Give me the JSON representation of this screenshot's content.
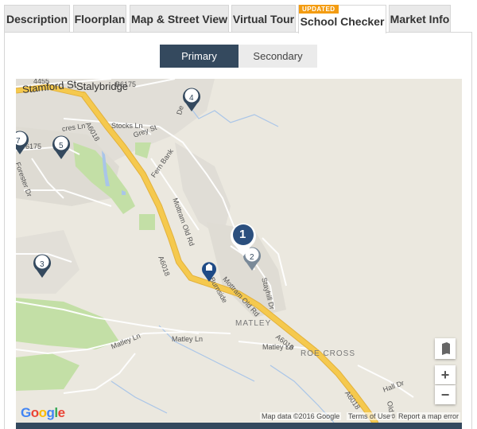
{
  "tabs": [
    {
      "label": "Description",
      "active": false
    },
    {
      "label": "Floorplan",
      "active": false
    },
    {
      "label": "Map & Street View",
      "active": false
    },
    {
      "label": "Virtual Tour",
      "active": false
    },
    {
      "label": "School Checker",
      "active": true,
      "badge": "UPDATED"
    },
    {
      "label": "Market Info",
      "active": false
    }
  ],
  "toggle": {
    "primary": "Primary",
    "secondary": "Secondary",
    "selected": "Primary"
  },
  "map": {
    "labels": {
      "stamford": "Stamford St",
      "stalybridge": "Stalybridge",
      "a6018a": "A6018",
      "a6018b": "A6018",
      "a6018c": "A6018",
      "a6018d": "A6018",
      "b6175": "B6175",
      "n6175": "6175",
      "stocks": "Stocks Ln",
      "acres": "cres Ln",
      "grey": "Grey St",
      "forester": "Forester Dr",
      "fern": "Fern Bank",
      "mottram1": "Mottram Old Rd",
      "mottram2": "Mottram Old Rd",
      "burnside": "Burnside",
      "matley": "MATLEY",
      "matleyln1": "Matley Ln",
      "matleyln2": "Matley Ln",
      "matleyln3": "Matley Ln",
      "roe": "ROE CROSS",
      "hall": "Hall Dr",
      "oldp": "Old P",
      "stayhill": "Stayhill Dr",
      "de": "De",
      "n4455": "4455"
    },
    "pins": [
      {
        "id": "1",
        "label": "1"
      },
      {
        "id": "2",
        "label": "2"
      },
      {
        "id": "3",
        "label": "3"
      },
      {
        "id": "4",
        "label": "4"
      },
      {
        "id": "5",
        "label": "5"
      },
      {
        "id": "7",
        "label": "7"
      }
    ],
    "google": "Google",
    "footer": {
      "data": "Map data ©2016 Google",
      "terms": "Terms of Use",
      "report": "Report a map error"
    },
    "zoom_in": "+",
    "zoom_out": "−"
  },
  "colors": {
    "accent": "#34495e",
    "badge": "#f39c12",
    "road": "#f5c94e",
    "park": "#c3dfa6"
  }
}
